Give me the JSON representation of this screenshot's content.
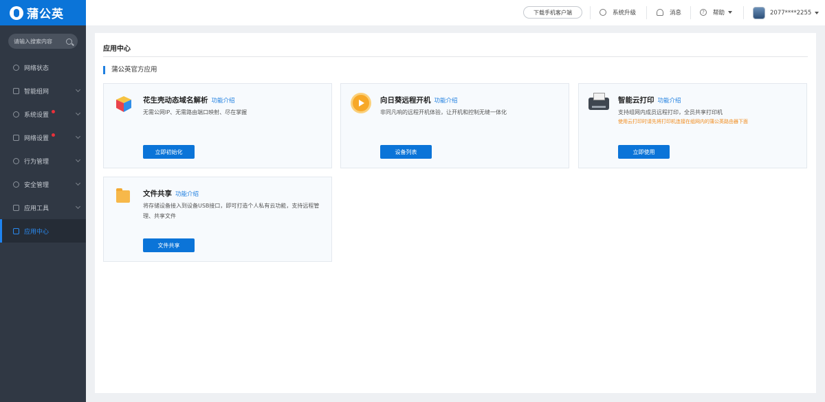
{
  "brand": {
    "name": "蒲公英"
  },
  "search": {
    "placeholder": "请输入搜索内容"
  },
  "sidebar": {
    "items": [
      {
        "label": "网络状态"
      },
      {
        "label": "智能组网"
      },
      {
        "label": "系统设置"
      },
      {
        "label": "网络设置"
      },
      {
        "label": "行为管理"
      },
      {
        "label": "安全管理"
      },
      {
        "label": "应用工具"
      },
      {
        "label": "应用中心"
      }
    ]
  },
  "topbar": {
    "download_label": "下载手机客户端",
    "upgrade_label": "系统升级",
    "messages_label": "消息",
    "help_label": "帮助",
    "user_label": "2077****2255"
  },
  "main": {
    "title": "应用中心",
    "section_title": "蒲公英官方应用",
    "cards": [
      {
        "title": "花生壳动态域名解析",
        "link": "功能介绍",
        "desc": "无需公网IP、无需路由端口映射、尽在掌握",
        "button": "立即初始化"
      },
      {
        "title": "向日葵远程开机",
        "link": "功能介绍",
        "desc": "非同凡响的远程开机体验，让开机和控制无缝一体化",
        "button": "设备列表"
      },
      {
        "title": "智能云打印",
        "link": "功能介绍",
        "desc": "支持组网内成员远程打印，全员共享打印机",
        "warn": "使用云打印时请先将打印机连接在组网内的蒲公英路由器下面",
        "button": "立即使用"
      },
      {
        "title": "文件共享",
        "link": "功能介绍",
        "desc": "将存储设备接入到设备USB接口，即可打造个人私有云功能，支持远程管理、共享文件",
        "button": "文件共享"
      }
    ]
  },
  "colors": {
    "accent": "#0b74d8",
    "sidebar_bg": "#303844",
    "warn": "#f08a1a",
    "badge_dot": "#e8303a"
  }
}
